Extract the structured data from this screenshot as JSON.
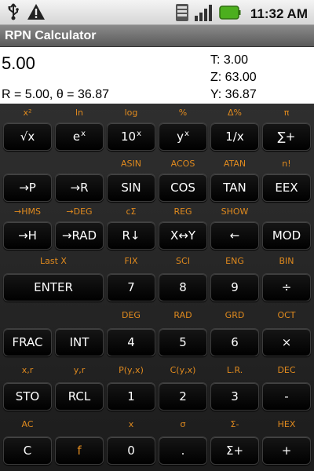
{
  "status": {
    "time": "11:32 AM",
    "icons": [
      "usb-icon",
      "warning-icon",
      "sd-card-icon",
      "signal-icon",
      "battery-icon"
    ]
  },
  "app": {
    "title": "RPN Calculator"
  },
  "display": {
    "x": "5.00",
    "polar": "R = 5.00, θ = 36.87",
    "stack": {
      "t": "T: 3.00",
      "z": "Z: 63.00",
      "y": "Y: 36.87"
    }
  },
  "colors": {
    "accent": "#e08a1e",
    "key_bg": "#000000",
    "panel": "#262626"
  },
  "keys": {
    "sqrt": "√x",
    "ex": "e",
    "ex_sup": "x",
    "tenx": "10",
    "tenx_sup": "x",
    "yx": "y",
    "yx_sup": "x",
    "inv": "1/x",
    "sum_plus": "∑+",
    "to_p": "→P",
    "to_r": "→R",
    "sin": "SIN",
    "cos": "COS",
    "tan": "TAN",
    "eex": "EEX",
    "to_h": "→H",
    "to_rad": "→RAD",
    "roll": "R↓",
    "swap": "X↔Y",
    "back": "←",
    "mod": "MOD",
    "enter": "ENTER",
    "k7": "7",
    "k8": "8",
    "k9": "9",
    "div": "÷",
    "frac": "FRAC",
    "int": "INT",
    "k4": "4",
    "k5": "5",
    "k6": "6",
    "mul": "×",
    "sto": "STO",
    "rcl": "RCL",
    "k1": "1",
    "k2": "2",
    "k3": "3",
    "sub": "-",
    "c": "C",
    "f": "f",
    "k0": "0",
    "dot": ".",
    "sigma_plus": "Σ+",
    "add": "+"
  },
  "labels": {
    "row1": [
      "x²",
      "ln",
      "log",
      "%",
      "Δ%",
      "π"
    ],
    "row2": [
      "ASIN",
      "ACOS",
      "ATAN",
      "n!"
    ],
    "row3": [
      "→HMS",
      "→DEG",
      "cΣ",
      "REG",
      "SHOW"
    ],
    "row4": [
      "Last X",
      "FIX",
      "SCI",
      "ENG",
      "BIN"
    ],
    "row5": [
      "DEG",
      "RAD",
      "GRD",
      "OCT"
    ],
    "row6": [
      "x,r",
      "y,r",
      "P(y,x)",
      "C(y,x)",
      "L.R.",
      "DEC"
    ],
    "row7": [
      "AC",
      "x",
      "σ",
      "Σ-",
      "HEX"
    ]
  }
}
